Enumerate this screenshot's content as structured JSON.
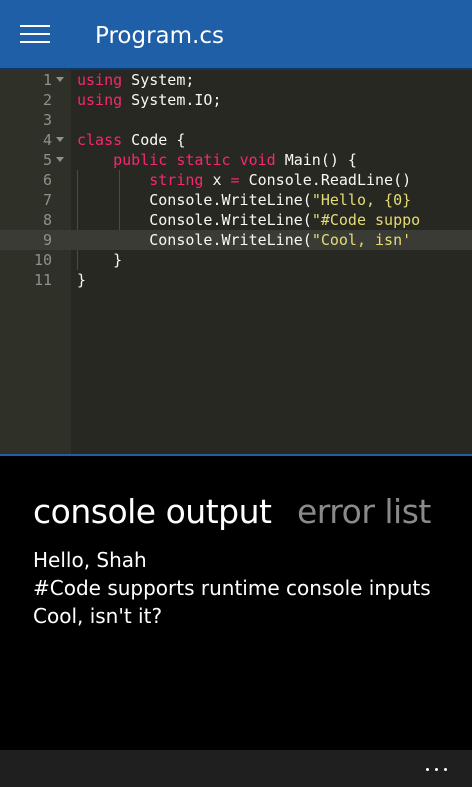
{
  "header": {
    "title": "Program.cs"
  },
  "editor": {
    "lines": [
      {
        "num": "1",
        "tokens": [
          [
            "kw",
            "using"
          ],
          [
            "plain",
            " System;"
          ]
        ]
      },
      {
        "num": "2",
        "tokens": [
          [
            "kw",
            "using"
          ],
          [
            "plain",
            " System.IO;"
          ]
        ]
      },
      {
        "num": "3",
        "tokens": []
      },
      {
        "num": "4",
        "tokens": [
          [
            "kw",
            "class"
          ],
          [
            "plain",
            " Code {"
          ]
        ]
      },
      {
        "num": "5",
        "tokens": [
          [
            "plain",
            "    "
          ],
          [
            "kw",
            "public"
          ],
          [
            "plain",
            " "
          ],
          [
            "kw",
            "static"
          ],
          [
            "plain",
            " "
          ],
          [
            "kw",
            "void"
          ],
          [
            "plain",
            " Main() {"
          ]
        ]
      },
      {
        "num": "6",
        "tokens": [
          [
            "plain",
            "        "
          ],
          [
            "kw",
            "string"
          ],
          [
            "plain",
            " x "
          ],
          [
            "kw",
            "="
          ],
          [
            "plain",
            " Console.ReadLine()"
          ]
        ]
      },
      {
        "num": "7",
        "tokens": [
          [
            "plain",
            "        Console.WriteLine("
          ],
          [
            "str",
            "\"Hello, {0}"
          ]
        ]
      },
      {
        "num": "8",
        "tokens": [
          [
            "plain",
            "        Console.WriteLine("
          ],
          [
            "str",
            "\"#Code suppo"
          ]
        ]
      },
      {
        "num": "9",
        "tokens": [
          [
            "plain",
            "        Console.WriteLine("
          ],
          [
            "str",
            "\"Cool, isn'"
          ]
        ]
      },
      {
        "num": "10",
        "tokens": [
          [
            "plain",
            "    }"
          ]
        ]
      },
      {
        "num": "11",
        "tokens": [
          [
            "plain",
            "}"
          ]
        ]
      }
    ],
    "fold_lines": [
      "1",
      "4",
      "5"
    ],
    "active_line": "9"
  },
  "panel": {
    "tabs": {
      "console": "console output",
      "errors": "error list"
    },
    "output": [
      "Hello, Shah",
      "#Code supports runtime console inputs",
      "Cool, isn't it?"
    ]
  },
  "appbar": {
    "more_icon": "ellipsis-icon"
  },
  "colors": {
    "titlebar": "#1f5fa8",
    "editor_bg": "#272822",
    "keyword": "#f92672",
    "string": "#e6db74"
  }
}
